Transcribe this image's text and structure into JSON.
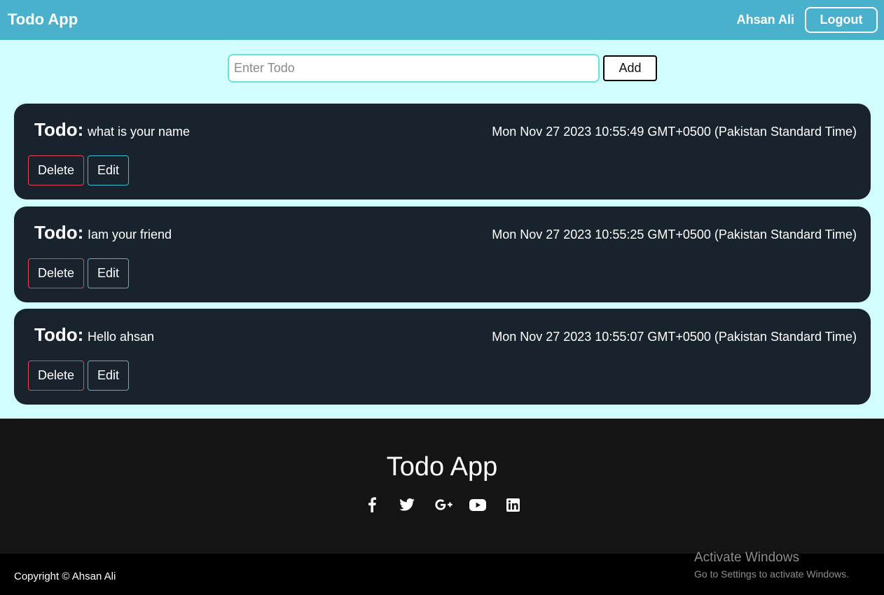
{
  "header": {
    "brand": "Todo App",
    "user_name": "Ahsan Ali",
    "logout_label": "Logout"
  },
  "form": {
    "input_value": "",
    "input_placeholder": "Enter Todo",
    "add_label": "Add"
  },
  "todos": [
    {
      "label": "Todo:",
      "text": "what is your name",
      "date": "Mon Nov 27 2023 10:55:49 GMT+0500 (Pakistan Standard Time)",
      "delete_label": "Delete",
      "edit_label": "Edit"
    },
    {
      "label": "Todo:",
      "text": "Iam your friend",
      "date": "Mon Nov 27 2023 10:55:25 GMT+0500 (Pakistan Standard Time)",
      "delete_label": "Delete",
      "edit_label": "Edit"
    },
    {
      "label": "Todo:",
      "text": "Hello ahsan",
      "date": "Mon Nov 27 2023 10:55:07 GMT+0500 (Pakistan Standard Time)",
      "delete_label": "Delete",
      "edit_label": "Edit"
    }
  ],
  "footer": {
    "title": "Todo App",
    "social_icons": [
      "facebook-icon",
      "twitter-icon",
      "google-plus-icon",
      "youtube-icon",
      "linkedin-icon"
    ],
    "copyright": "Copyright © Ahsan Ali"
  },
  "watermark": {
    "title": "Activate Windows",
    "subtitle": "Go to Settings to activate Windows."
  },
  "colors": {
    "navbar": "#4ab1cc",
    "page_background": "#d2fdff",
    "card_background": "#18232d",
    "delete_border": "#e0455a",
    "edit_border": "#3bbcd6",
    "footer_background": "#141414"
  }
}
